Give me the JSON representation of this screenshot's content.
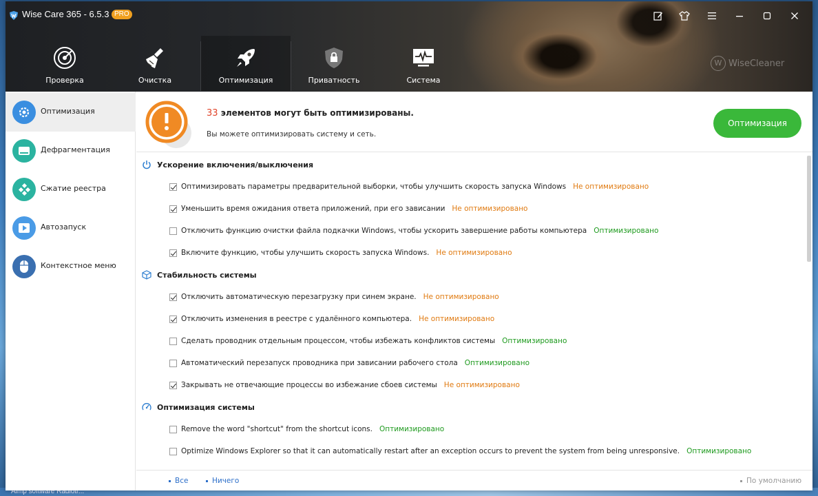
{
  "app": {
    "title": "Wise Care 365 - 6.5.3",
    "badge": "PRO",
    "watermark": "WiseCleaner",
    "watermark_logo": "W"
  },
  "titlebar": {
    "buttons": [
      "edit-icon",
      "skin-icon",
      "menu-icon",
      "minimize-icon",
      "maximize-icon",
      "close-icon"
    ]
  },
  "nav": {
    "items": [
      {
        "label": "Проверка",
        "icon": "radar-icon"
      },
      {
        "label": "Очистка",
        "icon": "broom-icon"
      },
      {
        "label": "Оптимизация",
        "icon": "rocket-icon"
      },
      {
        "label": "Приватность",
        "icon": "shield-lock-icon"
      },
      {
        "label": "Система",
        "icon": "monitor-pulse-icon"
      }
    ],
    "active_index": 2
  },
  "sidebar": {
    "items": [
      {
        "label": "Оптимизация",
        "icon": "gear-icon",
        "color": "#3a8ee0"
      },
      {
        "label": "Дефрагментация",
        "icon": "disk-icon",
        "color": "#2bb3a0"
      },
      {
        "label": "Сжатие реестра",
        "icon": "registry-icon",
        "color": "#2bb3a0"
      },
      {
        "label": "Автозапуск",
        "icon": "play-icon",
        "color": "#3a8ee0"
      },
      {
        "label": "Контекстное меню",
        "icon": "mouse-icon",
        "color": "#3a6fb0"
      }
    ],
    "active_index": 0
  },
  "banner": {
    "count": "33",
    "title_rest": "элементов могут быть оптимизированы.",
    "subtitle": "Вы можете оптимизировать систему и сеть.",
    "button_label": "Оптимизация"
  },
  "sections": [
    {
      "title": "Ускорение включения/выключения",
      "icon": "power-icon",
      "items": [
        {
          "text": "Оптимизировать параметры предварительной выборки, чтобы улучшить скорость запуска Windows",
          "checked": true,
          "status": "Не оптимизировано",
          "state": "bad"
        },
        {
          "text": "Уменьшить время ожидания ответа приложений, при его зависании",
          "checked": true,
          "status": "Не оптимизировано",
          "state": "bad"
        },
        {
          "text": "Отключить функцию очистки файла подкачки Windows, чтобы ускорить завершение работы компьютера",
          "checked": false,
          "status": "Оптимизировано",
          "state": "good"
        },
        {
          "text": "Включите функцию, чтобы улучшить скорость запуска Windows.",
          "checked": true,
          "status": "Не оптимизировано",
          "state": "bad"
        }
      ]
    },
    {
      "title": "Стабильность системы",
      "icon": "cube-icon",
      "items": [
        {
          "text": "Отключить автоматическую перезагрузку при синем экране.",
          "checked": true,
          "status": "Не оптимизировано",
          "state": "bad"
        },
        {
          "text": "Отключить изменения в реестре с удалённого компьютера.",
          "checked": true,
          "status": "Не оптимизировано",
          "state": "bad"
        },
        {
          "text": "Сделать проводник отдельным процессом, чтобы избежать конфликтов системы",
          "checked": false,
          "status": "Оптимизировано",
          "state": "good"
        },
        {
          "text": "Автоматический перезапуск проводника при зависании рабочего стола",
          "checked": false,
          "status": "Оптимизировано",
          "state": "good"
        },
        {
          "text": "Закрывать не отвечающие процессы во избежание сбоев системы",
          "checked": true,
          "status": "Не оптимизировано",
          "state": "bad"
        }
      ]
    },
    {
      "title": "Оптимизация системы",
      "icon": "speedometer-icon",
      "items": [
        {
          "text": "Remove the word \"shortcut\" from the shortcut icons.",
          "checked": false,
          "status": "Оптимизировано",
          "state": "good"
        },
        {
          "text": "Optimize Windows Explorer so that it can automatically restart after an exception occurs to prevent the system from being unresponsive.",
          "checked": false,
          "status": "Оптимизировано",
          "state": "good"
        }
      ]
    }
  ],
  "footer": {
    "all_label": "Все",
    "none_label": "Ничего",
    "default_label": "По умолчанию"
  },
  "desktop": {
    "text": "Aimp    software  Radiotr..."
  },
  "colors": {
    "accent_green": "#3ab83a",
    "warning_orange": "#f08a24",
    "status_bad": "#e07a10",
    "status_good": "#1e9a1e",
    "count_red": "#e0442a"
  }
}
